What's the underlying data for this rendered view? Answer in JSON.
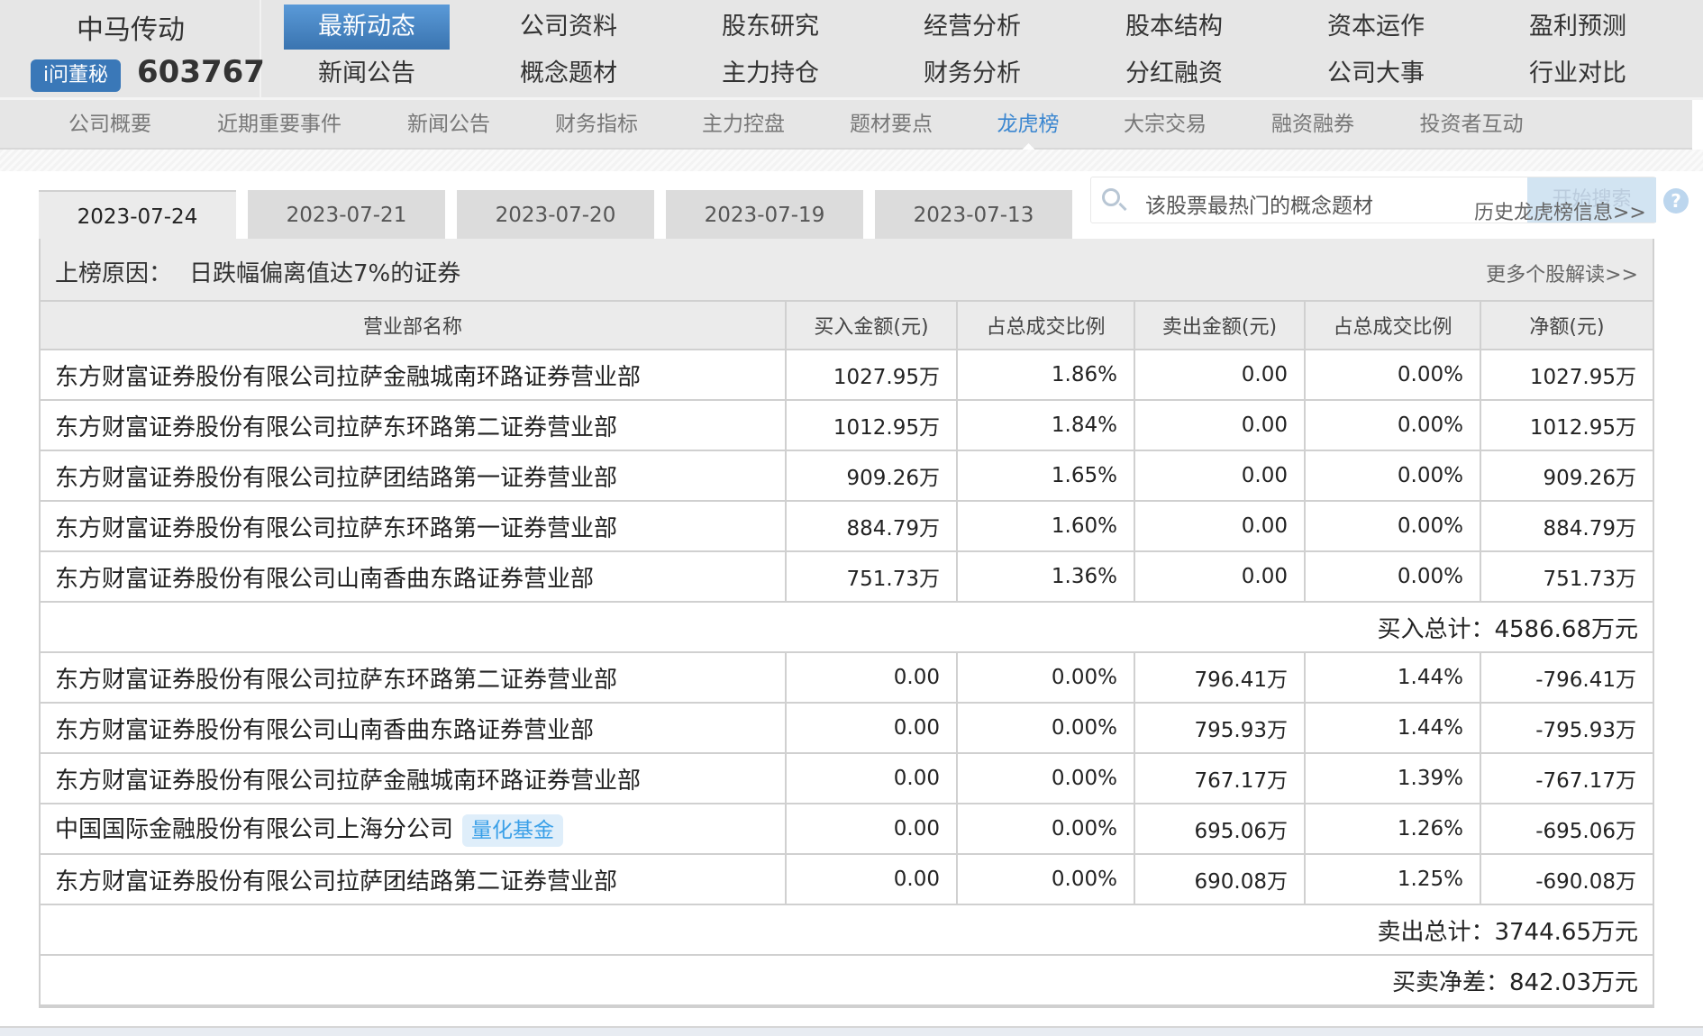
{
  "company": {
    "name": "中马传动",
    "badge": "i问董秘",
    "code": "603767"
  },
  "nav": {
    "row1": [
      "最新动态",
      "公司资料",
      "股东研究",
      "经营分析",
      "股本结构",
      "资本运作",
      "盈利预测"
    ],
    "row2": [
      "新闻公告",
      "概念题材",
      "主力持仓",
      "财务分析",
      "分红融资",
      "公司大事",
      "行业对比"
    ],
    "active": "最新动态"
  },
  "subnav": {
    "items": [
      "公司概要",
      "近期重要事件",
      "新闻公告",
      "财务指标",
      "主力控盘",
      "题材要点",
      "龙虎榜",
      "大宗交易",
      "融资融券",
      "投资者互动"
    ],
    "active": "龙虎榜"
  },
  "date_tabs": [
    "2023-07-24",
    "2023-07-21",
    "2023-07-20",
    "2023-07-19",
    "2023-07-13"
  ],
  "search": {
    "placeholder": "该股票最热门的概念题材",
    "button": "开始搜索",
    "history_link": "历史龙虎榜信息>>",
    "help": "?"
  },
  "reason": {
    "label": "上榜原因：",
    "value": "日跌幅偏离值达7%的证券",
    "more_link": "更多个股解读>>"
  },
  "table": {
    "headers": [
      "营业部名称",
      "买入金额(元)",
      "占总成交比例",
      "卖出金额(元)",
      "占总成交比例",
      "净额(元)"
    ],
    "buy_rows": [
      [
        "东方财富证券股份有限公司拉萨金融城南环路证券营业部",
        "1027.95万",
        "1.86%",
        "0.00",
        "0.00%",
        "1027.95万"
      ],
      [
        "东方财富证券股份有限公司拉萨东环路第二证券营业部",
        "1012.95万",
        "1.84%",
        "0.00",
        "0.00%",
        "1012.95万"
      ],
      [
        "东方财富证券股份有限公司拉萨团结路第一证券营业部",
        "909.26万",
        "1.65%",
        "0.00",
        "0.00%",
        "909.26万"
      ],
      [
        "东方财富证券股份有限公司拉萨东环路第一证券营业部",
        "884.79万",
        "1.60%",
        "0.00",
        "0.00%",
        "884.79万"
      ],
      [
        "东方财富证券股份有限公司山南香曲东路证券营业部",
        "751.73万",
        "1.36%",
        "0.00",
        "0.00%",
        "751.73万"
      ]
    ],
    "buy_total": "买入总计：4586.68万元",
    "sell_rows": [
      [
        "东方财富证券股份有限公司拉萨东环路第二证券营业部",
        "0.00",
        "0.00%",
        "796.41万",
        "1.44%",
        "-796.41万"
      ],
      [
        "东方财富证券股份有限公司山南香曲东路证券营业部",
        "0.00",
        "0.00%",
        "795.93万",
        "1.44%",
        "-795.93万"
      ],
      [
        "东方财富证券股份有限公司拉萨金融城南环路证券营业部",
        "0.00",
        "0.00%",
        "767.17万",
        "1.39%",
        "-767.17万"
      ],
      [
        "中国国际金融股份有限公司上海分公司",
        "0.00",
        "0.00%",
        "695.06万",
        "1.26%",
        "-695.06万"
      ],
      [
        "东方财富证券股份有限公司拉萨团结路第二证券营业部",
        "0.00",
        "0.00%",
        "690.08万",
        "1.25%",
        "-690.08万"
      ]
    ],
    "sell_tags": {
      "3": "量化基金"
    },
    "sell_total": "卖出总计：3744.65万元",
    "net": "买卖净差：842.03万元"
  }
}
